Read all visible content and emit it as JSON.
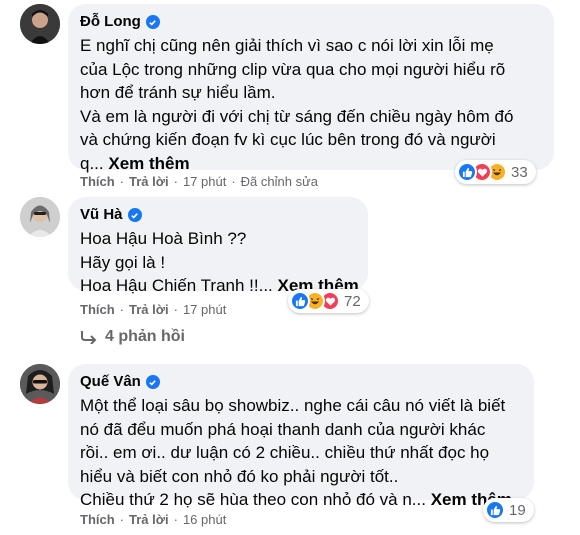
{
  "comments": [
    {
      "author": "Đỗ Long",
      "lines": [
        "E nghĩ chị cũng nên giải thích vì sao c nói lời xin lỗi mẹ",
        "của Lộc trong những clip vừa qua cho mọi người hiểu rõ",
        "hơn để tránh sự hiểu lầm.",
        "Và em là người đi với chị từ sáng đến chiều ngày hôm đó",
        "và chứng kiến đoạn fv kì cục lúc bên trong đó và người",
        "q..."
      ],
      "see_more": "Xem thêm",
      "like": "Thích",
      "reply": "Trả lời",
      "time": "17 phút",
      "edited": "Đã chỉnh sửa",
      "reaction_count": "33"
    },
    {
      "author": "Vũ Hà",
      "lines": [
        "Hoa Hậu Hoà Bình ??",
        "Hãy gọi là !",
        "Hoa Hậu Chiến Tranh !!..."
      ],
      "see_more": "Xem thêm",
      "like": "Thích",
      "reply": "Trả lời",
      "time": "17 phút",
      "reaction_count": "72",
      "replies_label": "4 phản hồi"
    },
    {
      "author": "Quế Vân",
      "lines": [
        "Một thể loại sâu bọ showbiz.. nghe cái câu nó viết là biết",
        "nó đã đểu muốn phá hoại thanh danh của người khác",
        "rồi.. em ơi.. dư luận có 2 chiều.. chiều thứ nhất đọc họ",
        "hiểu và biết con nhỏ đó ko phải người tốt..",
        "Chiều thứ 2 họ sẽ hùa theo con nhỏ đó và n..."
      ],
      "see_more": "Xem thêm",
      "like": "Thích",
      "reply": "Trả lời",
      "time": "16 phút",
      "reaction_count": "19"
    }
  ],
  "colors": {
    "like_blue": "#1877f2",
    "haha_yellow": "#f7b125",
    "love_red": "#f33e58",
    "bubble_bg": "#f0f2f5",
    "meta_gray": "#65676b"
  }
}
